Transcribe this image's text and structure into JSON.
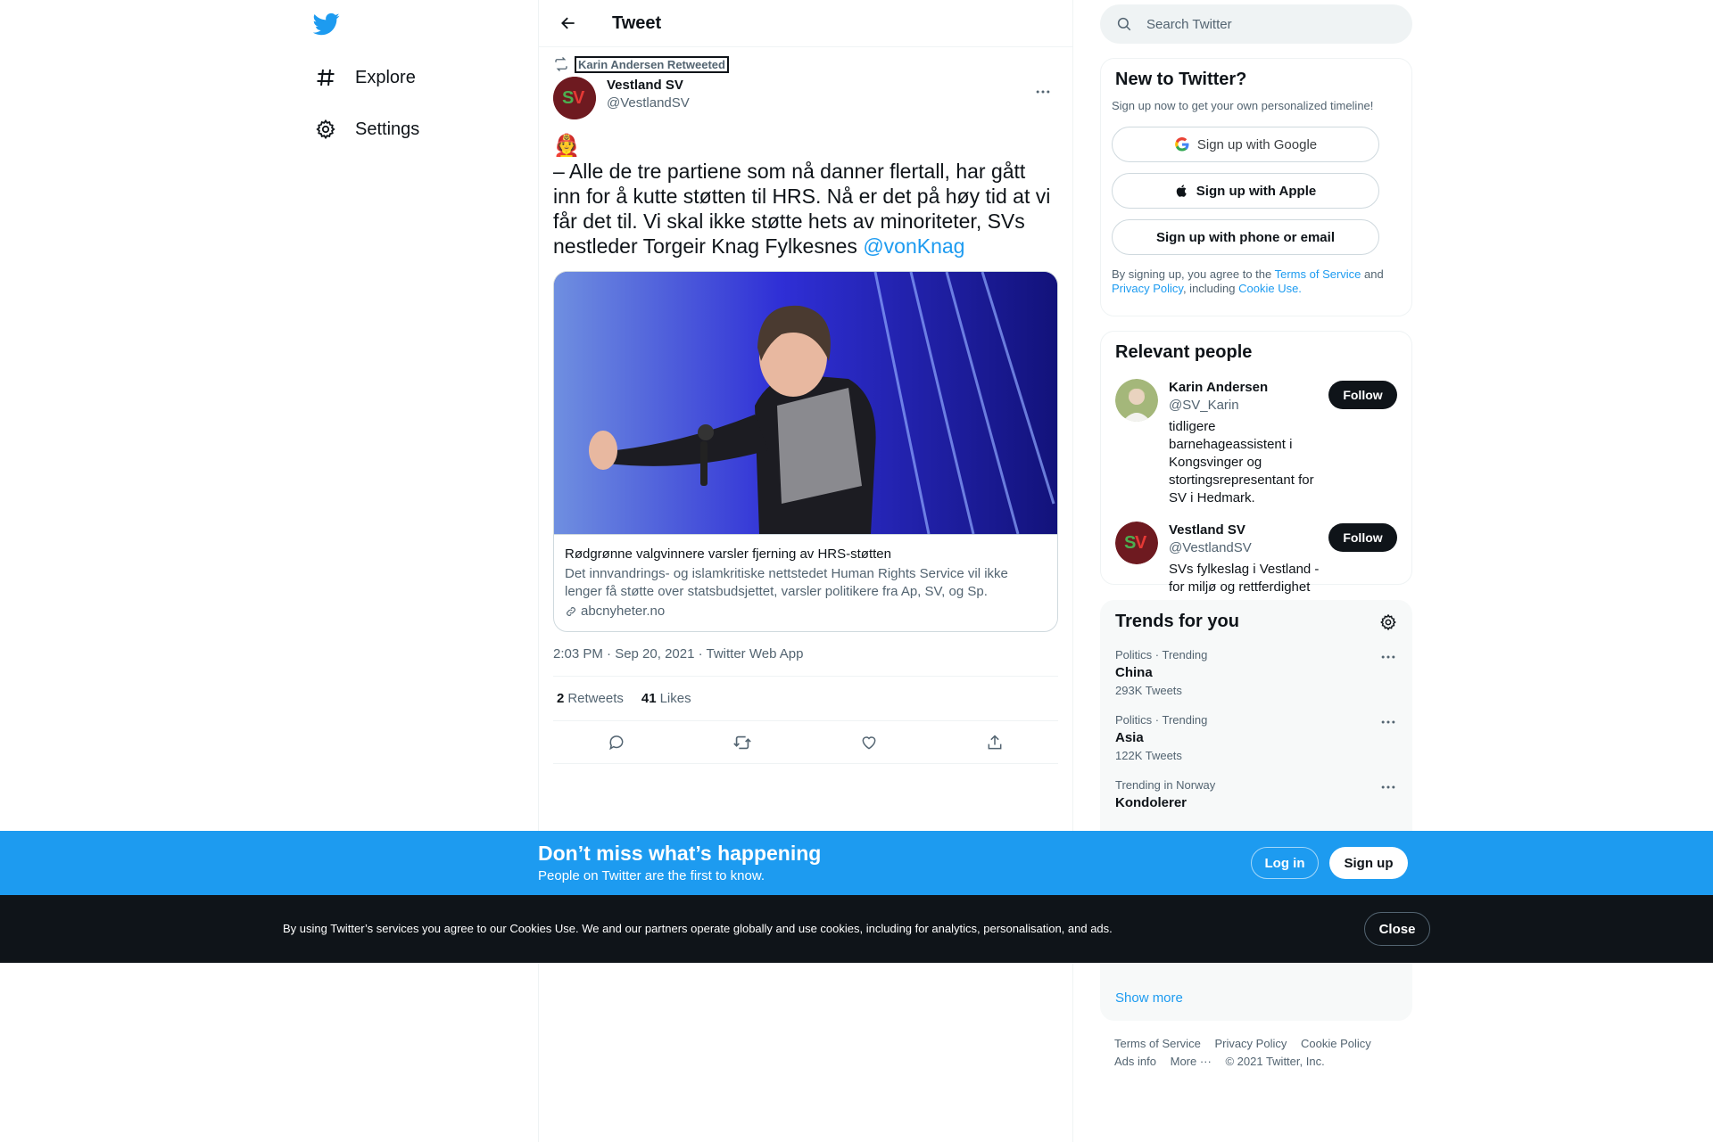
{
  "nav": {
    "logo_icon": "twitter-bird-icon",
    "items": [
      {
        "label": "Explore",
        "icon": "hashtag-icon"
      },
      {
        "label": "Settings",
        "icon": "gear-icon"
      }
    ]
  },
  "header": {
    "title": "Tweet"
  },
  "tweet": {
    "retweeted_by": "Karin Andersen Retweeted",
    "author_name": "Vestland SV",
    "author_handle": "@VestlandSV",
    "avatar_text": "SV",
    "emoji": "🧑‍🚒",
    "text": "– Alle de tre partiene som nå danner flertall, har gått inn for å kutte støtten til HRS. Nå er det på høy tid at vi får det til. Vi skal ikke støtte hets av minoriteter, SVs nestleder Torgeir Knag Fylkesnes ",
    "mention": "@vonKnag",
    "card": {
      "title": "Rødgrønne valgvinnere varsler fjerning av HRS-støtten",
      "description": "Det innvandrings- og islamkritiske nettstedet Human Rights Service vil ikke lenger få støtte over statsbudsjettet, varsler politikere fra Ap, SV, og Sp.",
      "domain": "abcnyheter.no"
    },
    "meta": "2:03 PM · Sep 20, 2021 · Twitter Web App",
    "retweets_count": "2",
    "retweets_label": "Retweets",
    "likes_count": "41",
    "likes_label": "Likes"
  },
  "search": {
    "placeholder": "Search Twitter"
  },
  "new_to_twitter": {
    "title": "New to Twitter?",
    "subtitle": "Sign up now to get your own personalized timeline!",
    "google_label": "Sign up with Google",
    "apple_label": "Sign up with Apple",
    "phone_label": "Sign up with phone or email",
    "terms_prefix": "By signing up, you agree to the ",
    "terms_link": "Terms of Service",
    "terms_and": " and",
    "privacy_link": "Privacy Policy",
    "terms_including": ", including ",
    "cookie_link": "Cookie Use."
  },
  "relevant": {
    "title": "Relevant people",
    "people": [
      {
        "name": "Karin Andersen",
        "handle": "@SV_Karin",
        "bio": "tidligere barnehageassistent i Kongsvinger og stortingsrepresentant for SV i Hedmark.",
        "follow": "Follow"
      },
      {
        "name": "Vestland SV",
        "handle": "@VestlandSV",
        "bio": "SVs fylkeslag i Vestland - for miljø og rettferdighet",
        "follow": "Follow"
      }
    ]
  },
  "trends": {
    "title": "Trends for you",
    "items": [
      {
        "context": "Politics · Trending",
        "name": "China",
        "count": "293K Tweets"
      },
      {
        "context": "Politics · Trending",
        "name": "Asia",
        "count": "122K Tweets"
      },
      {
        "context": "Trending in Norway",
        "name": "Kondolerer",
        "count": ""
      }
    ],
    "show_more": "Show more"
  },
  "footer": {
    "links": [
      "Terms of Service",
      "Privacy Policy",
      "Cookie Policy",
      "Ads info",
      "More ···",
      "© 2021 Twitter, Inc."
    ]
  },
  "signup_bar": {
    "title": "Don’t miss what’s happening",
    "subtitle": "People on Twitter are the first to know.",
    "login": "Log in",
    "signup": "Sign up"
  },
  "cookie_bar": {
    "text": "By using Twitter’s services you agree to our Cookies Use. We and our partners operate globally and use cookies, including for analytics, personalisation, and ads.",
    "close": "Close"
  },
  "colors": {
    "brand": "#1d9bf0",
    "dark": "#0f1419",
    "muted": "#536471"
  }
}
